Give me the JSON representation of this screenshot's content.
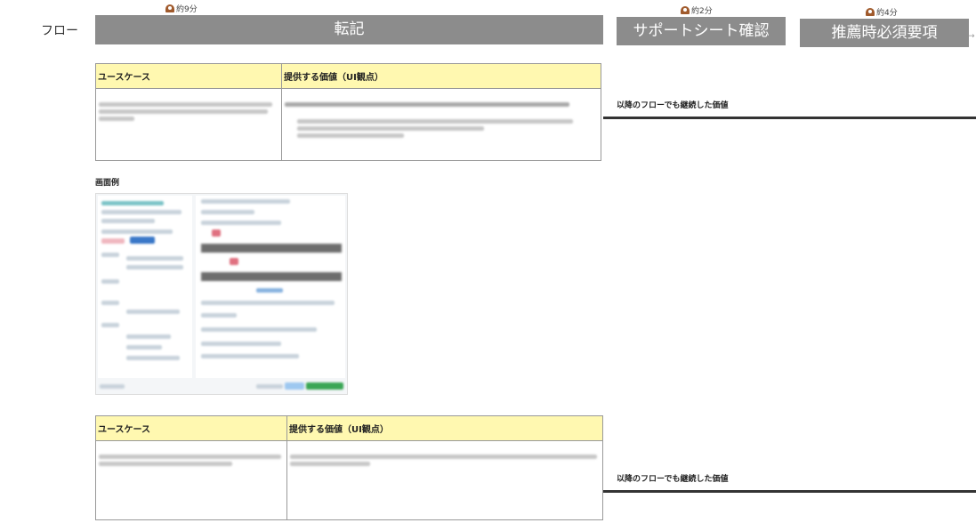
{
  "flow": {
    "label": "フロー"
  },
  "steps": [
    {
      "title": "転記",
      "duration": "約9分"
    },
    {
      "title": "サポートシート確認",
      "duration": "約2分"
    },
    {
      "title": "推薦時必須要項",
      "duration": "約4分"
    }
  ],
  "table1": {
    "header_usecase": "ユースケース",
    "header_value": "提供する価値（UI観点）"
  },
  "image_caption": "画面例",
  "table2": {
    "header_usecase": "ユースケース",
    "header_value": "提供する価値（UI観点）"
  },
  "persistent_value_label": "以降のフローでも継続した価値",
  "icons": {
    "duration": "clock-icon"
  }
}
